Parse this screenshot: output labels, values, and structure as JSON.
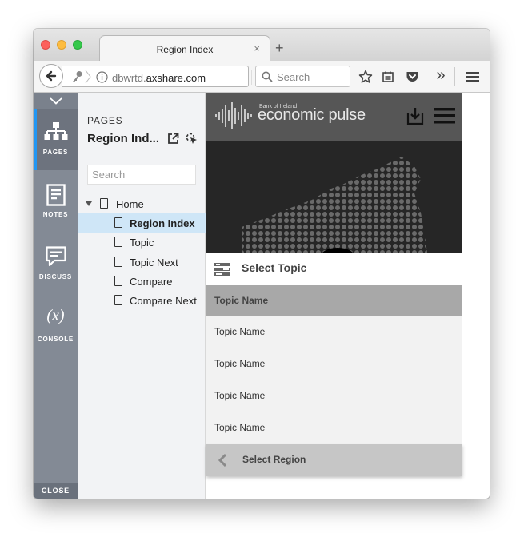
{
  "browser": {
    "tab_title": "Region Index",
    "tab_close": "×",
    "new_tab": "+",
    "url_prefix": "dbwrtd.",
    "url_domain": "axshare.com",
    "search_placeholder": "Search",
    "overflow": "»"
  },
  "rail": {
    "items": [
      {
        "label": "PAGES",
        "icon": "sitemap-icon",
        "active": true
      },
      {
        "label": "NOTES",
        "icon": "notes-icon",
        "active": false
      },
      {
        "label": "DISCUSS",
        "icon": "discuss-icon",
        "active": false
      },
      {
        "label": "CONSOLE",
        "icon": "console-icon",
        "active": false
      }
    ],
    "console_glyph": "(x)",
    "close_label": "CLOSE"
  },
  "pages_panel": {
    "heading": "PAGES",
    "current_page": "Region Ind...",
    "search_placeholder": "Search",
    "tree": [
      {
        "label": "Home",
        "level": 0,
        "expandable": true,
        "selected": false
      },
      {
        "label": "Region Index",
        "level": 1,
        "expandable": false,
        "selected": true
      },
      {
        "label": "Topic",
        "level": 1,
        "expandable": false,
        "selected": false
      },
      {
        "label": "Topic Next",
        "level": 1,
        "expandable": false,
        "selected": false
      },
      {
        "label": "Compare",
        "level": 1,
        "expandable": false,
        "selected": false
      },
      {
        "label": "Compare Next",
        "level": 1,
        "expandable": false,
        "selected": false
      }
    ]
  },
  "prototype": {
    "brand_small": "Bank of Ireland",
    "brand_title": "economic pulse",
    "select_topic_label": "Select Topic",
    "topic_header": "Topic Name",
    "topics": [
      "Topic Name",
      "Topic Name",
      "Topic Name",
      "Topic Name"
    ],
    "select_region_label": "Select Region"
  },
  "colors": {
    "accent": "#2196f3",
    "rail_bg": "#838a95",
    "selected_row": "#cfe6f7",
    "proto_header": "#565656"
  }
}
